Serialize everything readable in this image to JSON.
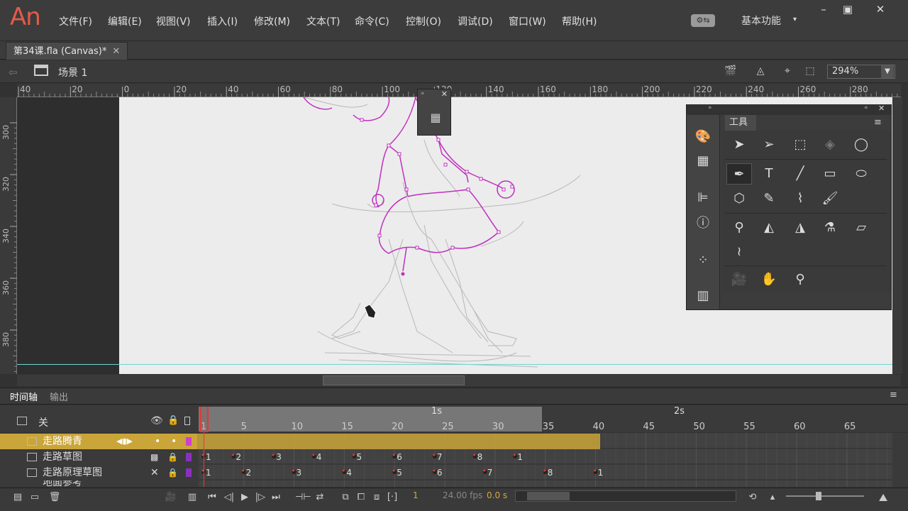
{
  "app": {
    "logo": "An",
    "menus": [
      "文件(F)",
      "编辑(E)",
      "视图(V)",
      "插入(I)",
      "修改(M)",
      "文本(T)",
      "命令(C)",
      "控制(O)",
      "调试(D)",
      "窗口(W)",
      "帮助(H)"
    ],
    "workspace": "基本功能",
    "window_buttons": [
      "minimize-icon",
      "restore-icon",
      "close-icon"
    ]
  },
  "document": {
    "tab_title": "第34课.fla (Canvas)*",
    "scene": "场景 1",
    "zoom": "294%"
  },
  "rulers": {
    "horizontal": [
      "40",
      "20",
      "0",
      "20",
      "40",
      "60",
      "80",
      "100",
      "120",
      "140",
      "160",
      "180",
      "200",
      "220",
      "240",
      "260",
      "280"
    ],
    "vertical": [
      "300",
      "320",
      "340",
      "360",
      "380"
    ]
  },
  "tools_panel": {
    "title": "工具",
    "strip_icons": [
      "color-palette-icon",
      "swatches-icon",
      "align-icon",
      "info-icon",
      "motion-presets-icon",
      "library-icon"
    ],
    "tools": [
      "selection-tool-icon",
      "subselection-tool-icon",
      "free-transform-tool-icon",
      "3d-rotation-tool-icon",
      "lasso-tool-icon",
      "pen-tool-icon",
      "text-tool-icon",
      "line-tool-icon",
      "rectangle-tool-icon",
      "oval-tool-icon",
      "polystar-tool-icon",
      "pencil-tool-icon",
      "paint-brush-tool-icon",
      "brush-tool-icon",
      "bone-tool-icon",
      "paint-bucket-tool-icon",
      "ink-bottle-tool-icon",
      "eyedropper-tool-icon",
      "eraser-tool-icon",
      "width-tool-icon",
      "camera-tool-icon",
      "hand-tool-icon",
      "zoom-tool-icon"
    ]
  },
  "timeline": {
    "tabs": [
      "时间轴",
      "输出"
    ],
    "header_label": "关",
    "seconds": [
      "1s",
      "2s"
    ],
    "frame_numbers": [
      "1",
      "5",
      "10",
      "15",
      "20",
      "25",
      "30",
      "35",
      "40",
      "45",
      "50",
      "55",
      "60",
      "65"
    ],
    "layers": [
      {
        "name": "走路腾青",
        "selected": true
      },
      {
        "name": "走路草图",
        "selected": false
      },
      {
        "name": "走路原理草图",
        "selected": false
      },
      {
        "name": "地面参考",
        "selected": false
      }
    ],
    "row2_keys": [
      "1",
      "2",
      "3",
      "4",
      "5",
      "6",
      "7",
      "8",
      "1"
    ],
    "row3_keys": [
      "1",
      "2",
      "3",
      "4",
      "5",
      "6",
      "7",
      "8",
      "1"
    ],
    "current_frame": "1",
    "fps": "24.00 fps",
    "time": "0.0 s"
  },
  "colors": {
    "accent": "#c9a53a",
    "playhead": "#e03a3a",
    "onion_path": "#c030c0",
    "logo": "#e55a4a"
  }
}
